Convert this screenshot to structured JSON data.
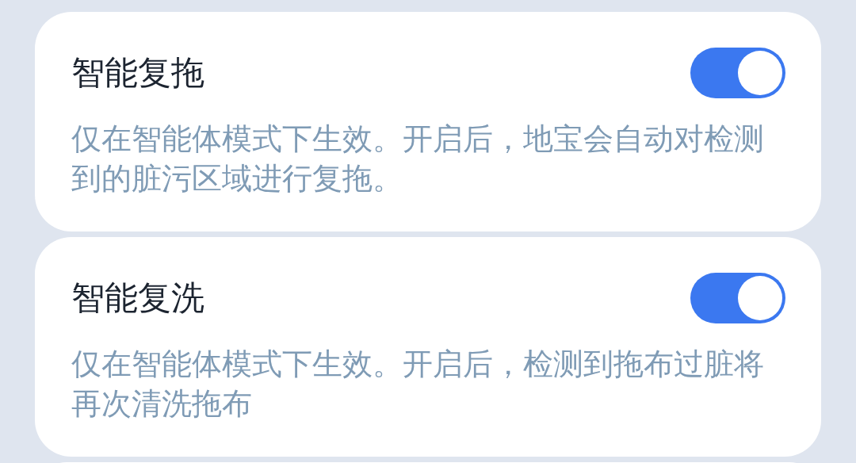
{
  "settings": [
    {
      "title": "智能复拖",
      "on": true,
      "description": "仅在智能体模式下生效。开启后，地宝会自动对检测到的脏污区域进行复拖。"
    },
    {
      "title": "智能复洗",
      "on": true,
      "description": "仅在智能体模式下生效。开启后，检测到拖布过脏将再次清洗拖布"
    }
  ]
}
